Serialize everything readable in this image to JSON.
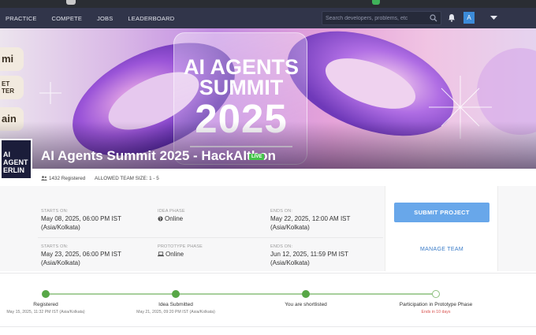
{
  "colors": {
    "nav_bg": "#31354a",
    "accent": "#68a7ea",
    "progress_green": "#58a747",
    "live_green": "#44c44a",
    "warn_red": "#d9534f"
  },
  "nav": {
    "links": [
      "PRACTICE",
      "COMPETE",
      "JOBS",
      "LEADERBOARD"
    ],
    "search_placeholder": "Search developers, problems, etc",
    "avatar_letter": "A",
    "icons": [
      "search-icon",
      "bell-icon",
      "chevron-down-icon"
    ]
  },
  "banner": {
    "card_line1": "AI AGENTS",
    "card_line2": "SUMMIT",
    "card_line3": "2025",
    "left_chips": [
      "mi",
      "ET\nTER",
      "ain"
    ],
    "logo_text": "AI\nAGENT\nERLIN"
  },
  "event": {
    "title": "AI Agents Summit 2025 - HackAIthon",
    "status_badge": "LIVE",
    "registered": "1432 Registered",
    "team_size": "ALLOWED TEAM SIZE: 1 - 5"
  },
  "schedule": [
    {
      "label": "STARTS ON:",
      "value": "May 08, 2025, 06:00 PM IST",
      "tz": "(Asia/Kolkata)"
    },
    {
      "label": "IDEA PHASE",
      "value": "Online"
    },
    {
      "label": "ENDS ON:",
      "value": "May 22, 2025, 12:00 AM IST",
      "tz": "(Asia/Kolkata)"
    },
    {
      "label": "STARTS ON:",
      "value": "May 23, 2025, 06:00 PM IST",
      "tz": "(Asia/Kolkata)"
    },
    {
      "label": "PROTOTYPE PHASE",
      "value": "Online"
    },
    {
      "label": "ENDS ON:",
      "value": "Jun 12, 2025, 11:59 PM IST",
      "tz": "(Asia/Kolkata)"
    }
  ],
  "actions": {
    "submit": "SUBMIT PROJECT",
    "manage": "MANAGE TEAM"
  },
  "progress": [
    {
      "name": "Registered",
      "sub": "May 15, 2025, 11:32 PM IST (Asia/Kolkata)",
      "done": true
    },
    {
      "name": "Idea Submitted",
      "sub": "May 21, 2025, 09:20 PM IST (Asia/Kolkata)",
      "done": true
    },
    {
      "name": "You are shortlisted",
      "sub": "",
      "done": true
    },
    {
      "name": "Participation in Prototype Phase",
      "sub": "Ends in 10 days",
      "done": false
    }
  ]
}
